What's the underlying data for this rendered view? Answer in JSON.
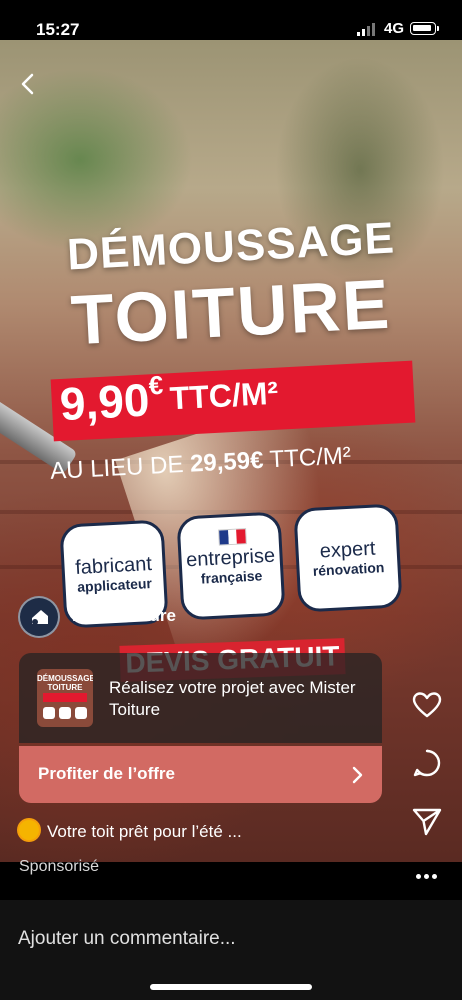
{
  "status": {
    "time": "15:27",
    "network": "4G"
  },
  "ad": {
    "headline1": "DÉMOUSSAGE",
    "headline2": "TOITURE",
    "price_value": "9,90",
    "price_currency": "€",
    "price_unit": "TTC/M²",
    "instead_prefix": "AU LIEU DE ",
    "instead_price": "29,59€",
    "instead_suffix": " TTC/M²",
    "badges": [
      {
        "line1": "fabricant",
        "line2": "applicateur"
      },
      {
        "line1": "entreprise",
        "line2": "française"
      },
      {
        "line1": "expert",
        "line2": "rénovation"
      }
    ],
    "devis": "DEVIS GRATUIT"
  },
  "profile": {
    "name": "mistertoiture"
  },
  "card": {
    "thumb_title": "DÉMOUSSAGE TOITURE",
    "thumb_price": "9,90€ TTC/M²",
    "text": "Réalisez votre projet avec Mister Toiture"
  },
  "cta": {
    "label": "Profiter de l’offre"
  },
  "caption": "Votre toit prêt pour l’été ...",
  "sponsored": "Sponsorisé",
  "comment_placeholder": "Ajouter un commentaire...",
  "colors": {
    "accent_red": "#e3192f",
    "cta": "#d26a63",
    "badge_navy": "#1b2a4a"
  }
}
